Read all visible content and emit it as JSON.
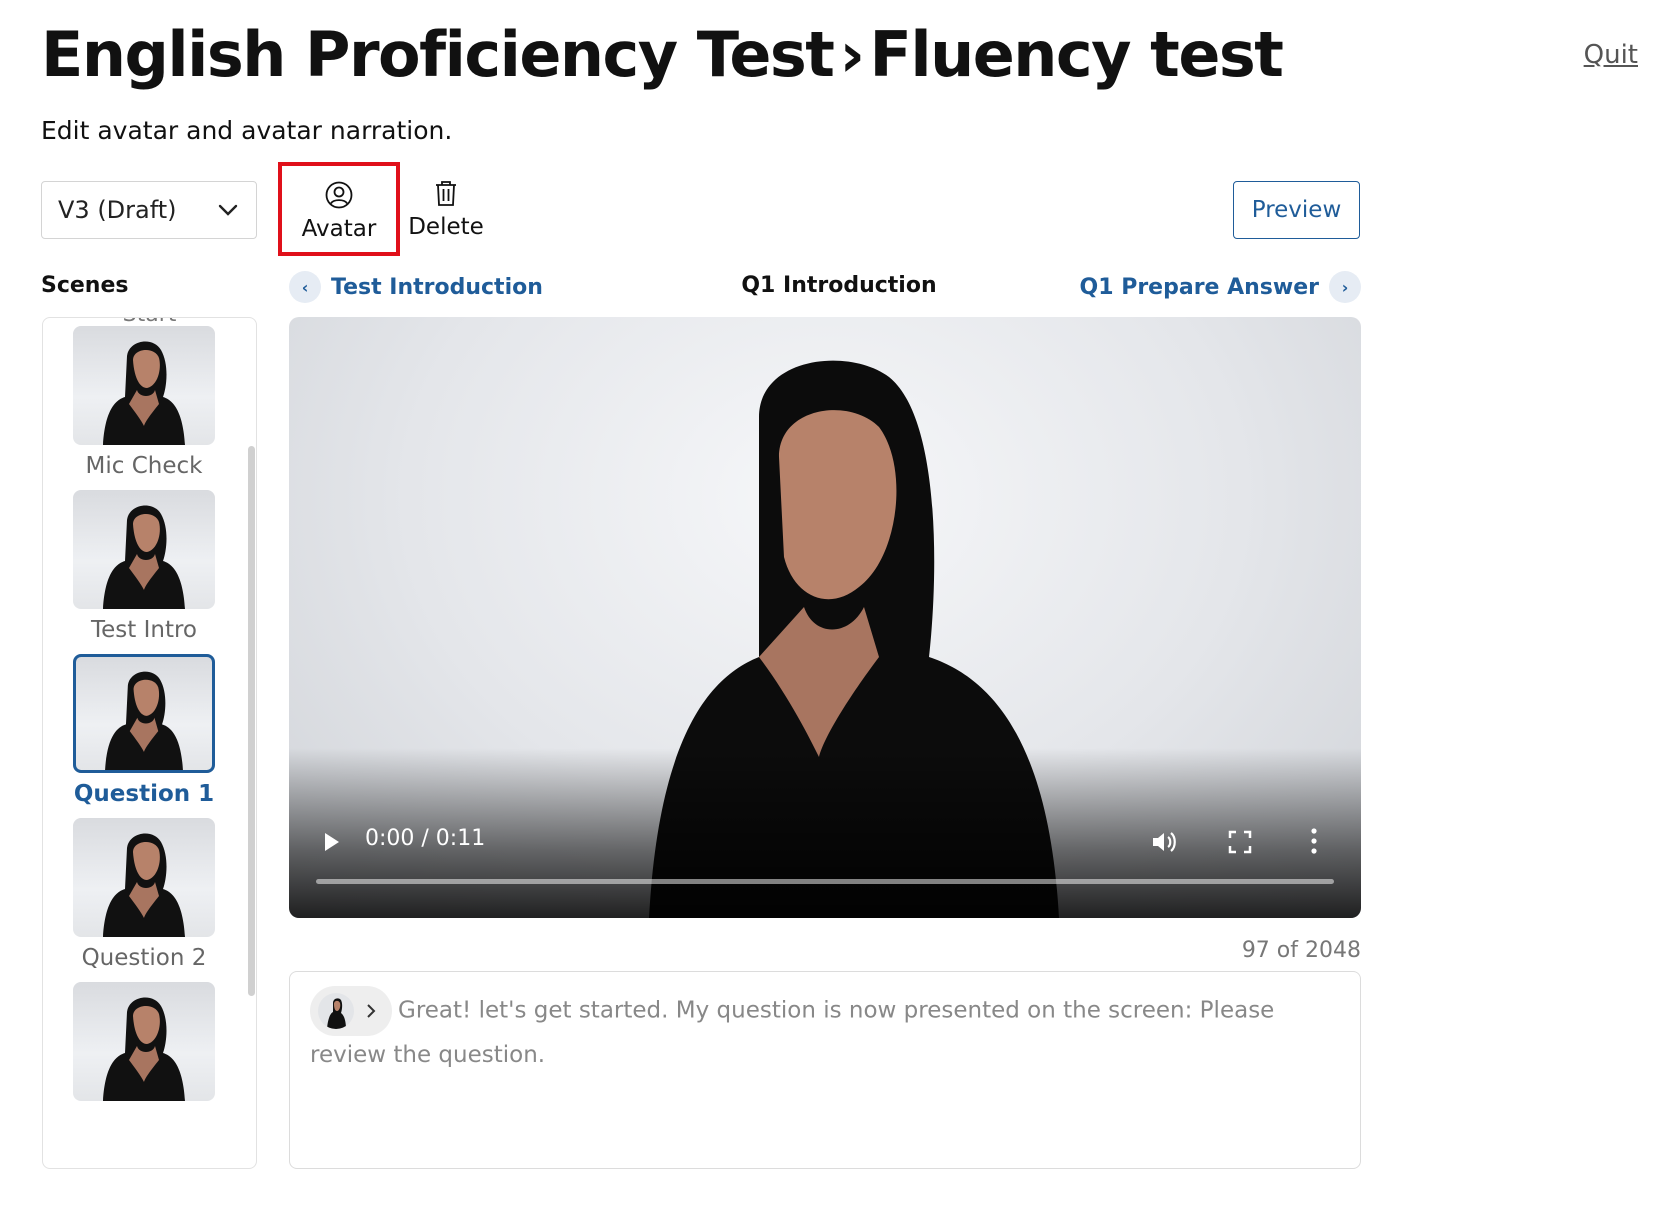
{
  "header": {
    "title_main": "English Proficiency Test",
    "title_sep": "›",
    "title_sub": "Fluency test",
    "subtitle": "Edit avatar and avatar narration.",
    "quit_label": "Quit"
  },
  "toolbar": {
    "version_selected": "V3 (Draft)",
    "avatar_label": "Avatar",
    "delete_label": "Delete",
    "preview_label": "Preview"
  },
  "scenes": {
    "label": "Scenes",
    "partial_top": "Start",
    "items": [
      {
        "label": "Mic Check",
        "selected": false
      },
      {
        "label": "Test Intro",
        "selected": false
      },
      {
        "label": "Question 1",
        "selected": true
      },
      {
        "label": "Question 2",
        "selected": false
      },
      {
        "label": "",
        "selected": false
      }
    ]
  },
  "scene_nav": {
    "prev": "Test Introduction",
    "current": "Q1 Introduction",
    "next": "Q1 Prepare Answer"
  },
  "video": {
    "time": "0:00 / 0:11",
    "progress_fraction": 0
  },
  "narration": {
    "char_count": "97 of 2048",
    "text": "Great! let's get started. My question is now presented on the screen: Please review the question."
  },
  "colors": {
    "accent": "#1f5c99",
    "highlight_box": "#e0101a"
  }
}
